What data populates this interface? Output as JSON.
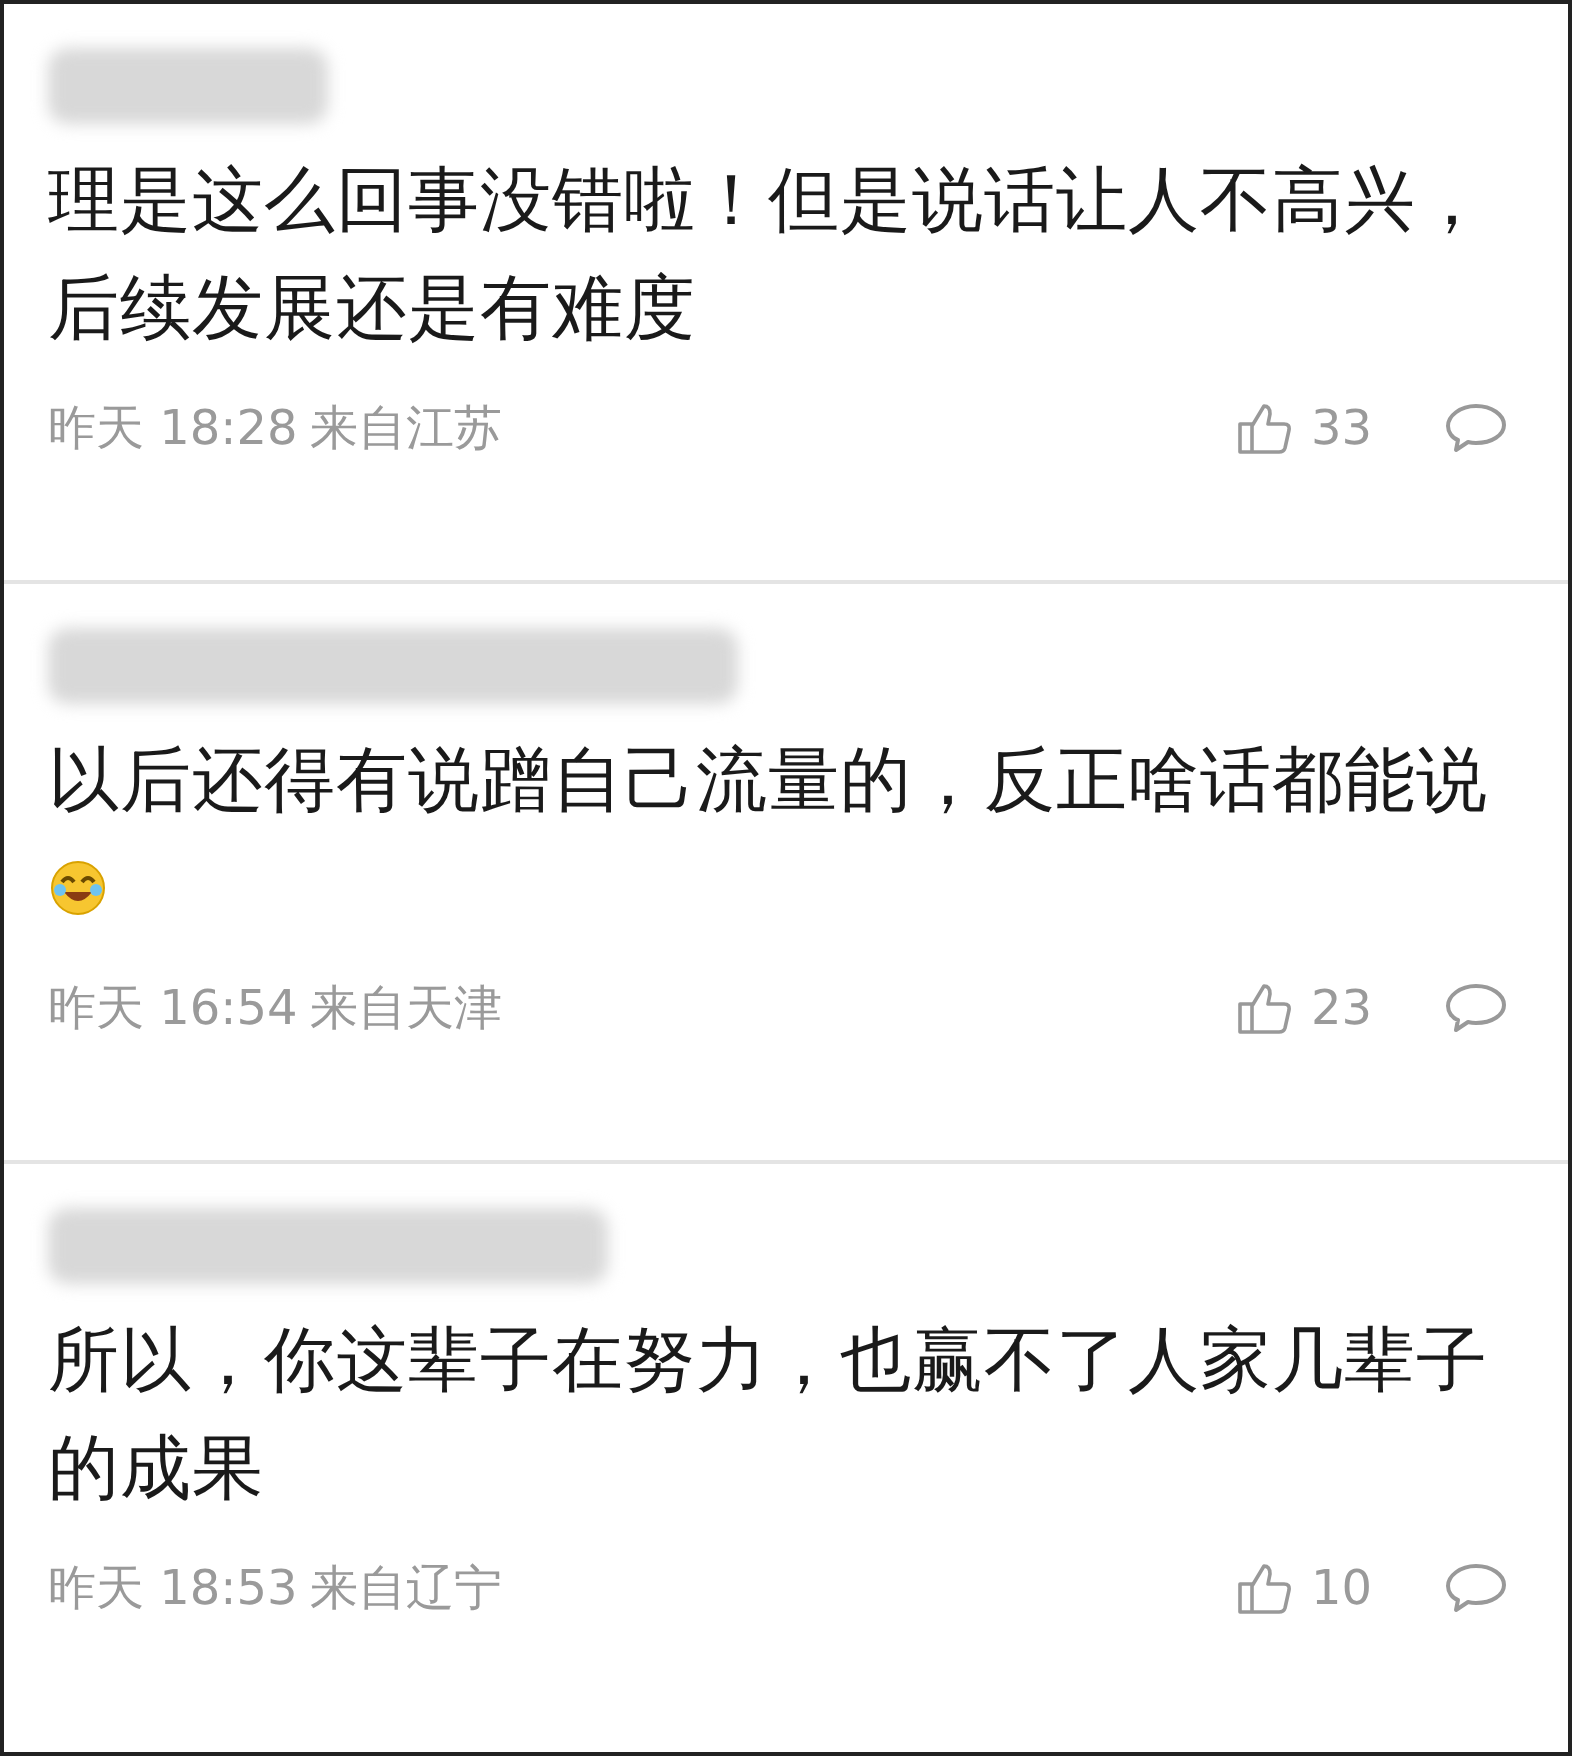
{
  "comments": [
    {
      "text": "理是这么回事没错啦！但是说话让人不高兴，后续发展还是有难度",
      "emoji": false,
      "time": "昨天 18:28",
      "location": "来自江苏",
      "likes": "33"
    },
    {
      "text": "以后还得有说蹭自己流量的，反正啥话都能说",
      "emoji": true,
      "time": "昨天 16:54",
      "location": "来自天津",
      "likes": "23"
    },
    {
      "text": "所以，你这辈子在努力，也赢不了人家几辈子的成果",
      "emoji": false,
      "time": "昨天 18:53",
      "location": "来自辽宁",
      "likes": "10"
    }
  ]
}
